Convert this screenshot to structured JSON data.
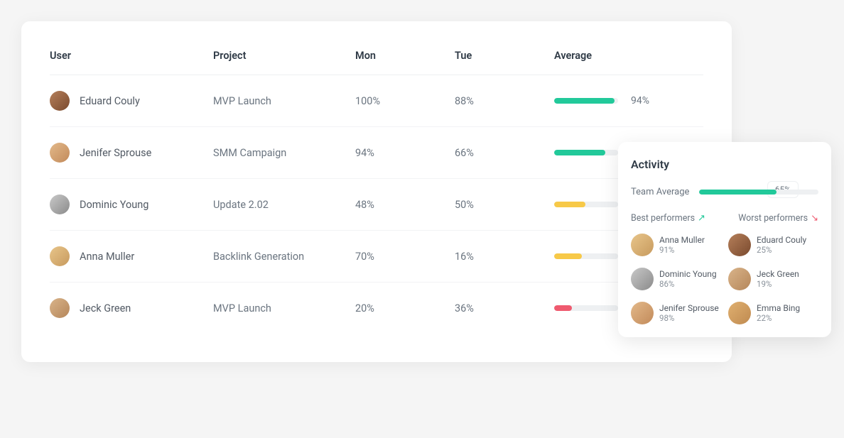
{
  "columns": {
    "user": "User",
    "project": "Project",
    "mon": "Mon",
    "tue": "Tue",
    "average": "Average"
  },
  "rows": [
    {
      "name": "Eduard Couly",
      "project": "MVP Launch",
      "mon": "100%",
      "tue": "88%",
      "avg_pct": 94,
      "avg_label": "94%",
      "avg_color": "green",
      "avatar_bg": "linear-gradient(135deg,#b57f5a,#7a4a2e)"
    },
    {
      "name": "Jenifer Sprouse",
      "project": "SMM Campaign",
      "mon": "94%",
      "tue": "66%",
      "avg_pct": 80,
      "avg_label": "",
      "avg_color": "green",
      "avatar_bg": "linear-gradient(135deg,#e3b98a,#c28a5a)"
    },
    {
      "name": "Dominic Young",
      "project": "Update 2.02",
      "mon": "48%",
      "tue": "50%",
      "avg_pct": 49,
      "avg_label": "",
      "avg_color": "yellow",
      "avatar_bg": "linear-gradient(135deg,#c9c9c9,#8a8a8a)"
    },
    {
      "name": "Anna Muller",
      "project": "Backlink Generation",
      "mon": "70%",
      "tue": "16%",
      "avg_pct": 43,
      "avg_label": "",
      "avg_color": "yellow",
      "avatar_bg": "linear-gradient(135deg,#e8c58a,#c79a5e)"
    },
    {
      "name": "Jeck Green",
      "project": "MVP Launch",
      "mon": "20%",
      "tue": "36%",
      "avg_pct": 28,
      "avg_label": "",
      "avg_color": "red",
      "avatar_bg": "linear-gradient(135deg,#d9b48a,#b5865a)"
    }
  ],
  "activity": {
    "title": "Activity",
    "team_avg_label": "Team Average",
    "team_avg_value": "65%",
    "team_avg_pct": 65,
    "best_title": "Best performers",
    "worst_title": "Worst performers",
    "best": [
      {
        "name": "Anna Muller",
        "pct": "91%",
        "avatar_bg": "linear-gradient(135deg,#e8c58a,#c79a5e)"
      },
      {
        "name": "Dominic Young",
        "pct": "86%",
        "avatar_bg": "linear-gradient(135deg,#c9c9c9,#8a8a8a)"
      },
      {
        "name": "Jenifer Sprouse",
        "pct": "98%",
        "avatar_bg": "linear-gradient(135deg,#e3b98a,#c28a5a)"
      }
    ],
    "worst": [
      {
        "name": "Eduard Couly",
        "pct": "25%",
        "avatar_bg": "linear-gradient(135deg,#b57f5a,#7a4a2e)"
      },
      {
        "name": "Jeck Green",
        "pct": "19%",
        "avatar_bg": "linear-gradient(135deg,#d9b48a,#b5865a)"
      },
      {
        "name": "Emma Bing",
        "pct": "22%",
        "avatar_bg": "linear-gradient(135deg,#e0b070,#bf8a50)"
      }
    ]
  }
}
